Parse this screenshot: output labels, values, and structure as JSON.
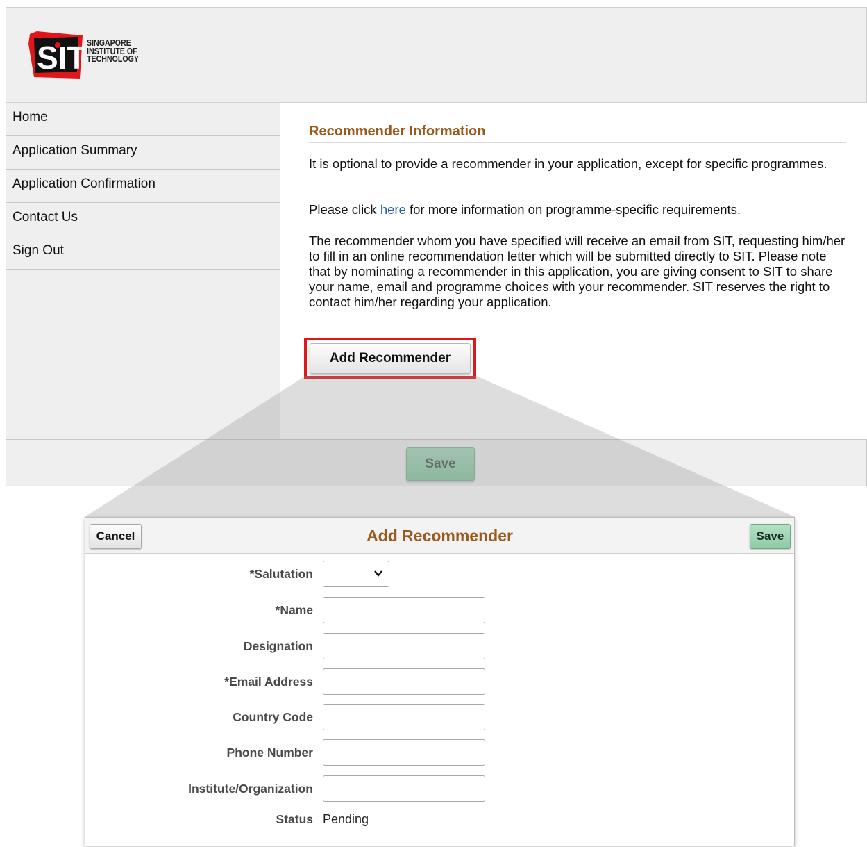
{
  "header": {
    "logo_lines": [
      "SINGAPORE",
      "INSTITUTE OF",
      "TECHNOLOGY"
    ],
    "logo_mark": "SIT"
  },
  "sidebar": {
    "items": [
      {
        "label": "Home"
      },
      {
        "label": "Application Summary"
      },
      {
        "label": "Application Confirmation"
      },
      {
        "label": "Contact Us"
      },
      {
        "label": "Sign Out"
      }
    ]
  },
  "main": {
    "title": "Recommender Information",
    "para1": "It is optional to provide a recommender in your application, except for specific programmes.",
    "para2_before": "Please click ",
    "para2_link": "here",
    "para2_after": " for more information on programme-specific requirements.",
    "para3": "The recommender whom you have specified will receive an email from SIT, requesting him/her to fill in an online recommendation letter which will be submitted directly to SIT. Please note that by nominating a recommender in this application, you are giving consent to SIT to share your name, email and programme choices with your recommender. SIT reserves the right to contact him/her regarding your application.",
    "add_button": "Add Recommender",
    "save_button": "Save"
  },
  "modal": {
    "title": "Add Recommender",
    "cancel": "Cancel",
    "save": "Save",
    "fields": [
      {
        "label": "*Salutation",
        "type": "select",
        "value": ""
      },
      {
        "label": "*Name",
        "type": "text",
        "value": ""
      },
      {
        "label": "Designation",
        "type": "text",
        "value": ""
      },
      {
        "label": "*Email Address",
        "type": "text",
        "value": ""
      },
      {
        "label": "Country Code",
        "type": "text",
        "value": ""
      },
      {
        "label": "Phone Number",
        "type": "text",
        "value": ""
      },
      {
        "label": "Institute/Organization",
        "type": "text",
        "value": ""
      }
    ],
    "status_label": "Status",
    "status_value": "Pending"
  },
  "colors": {
    "accent_title": "#9b5a1d",
    "highlight": "#e0161b",
    "save_green": "#8ac8a4",
    "logo_red": "#e0161b"
  }
}
